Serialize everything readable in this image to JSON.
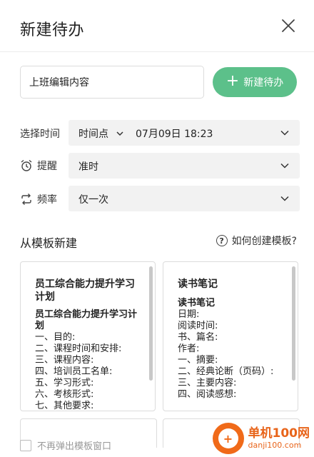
{
  "dialog": {
    "title": "新建待办"
  },
  "todo": {
    "input_value": "上班编辑内容",
    "new_button_label": "新建待办"
  },
  "schedule": {
    "time_label": "选择时间",
    "time_mode": "时间点",
    "time_value": "07月09日 18:23",
    "remind_label": "提醒",
    "remind_value": "准时",
    "repeat_label": "频率",
    "repeat_value": "仅一次"
  },
  "templates": {
    "section_title": "从模板新建",
    "help_label": "如何创建模板?",
    "cards": [
      {
        "title": "员工综合能力提升学习计划",
        "body_heading": "员工综合能力提升学习计划",
        "lines": [
          "一、目的:",
          "二、课程时间和安排:",
          "三、课程内容:",
          "四、培训员工名单:",
          "五、学习形式:",
          "六、考核形式:",
          "七、其他要求:"
        ]
      },
      {
        "title": "读书笔记",
        "body_heading": "读书笔记",
        "lines": [
          "日期:",
          "阅读时间:",
          "书、篇名:",
          "作者:",
          "一、摘要:",
          "二、经典论断（页码）:",
          "三、主要内容:",
          "四、阅读感想:"
        ]
      }
    ]
  },
  "footer": {
    "dont_show_label": "不再弹出模板窗口"
  },
  "watermark": {
    "name": "单机100网",
    "url": "danji100.com"
  },
  "colors": {
    "accent": "#5cc08a",
    "field_bg": "#f2f2f2",
    "watermark": "#e8641a"
  }
}
